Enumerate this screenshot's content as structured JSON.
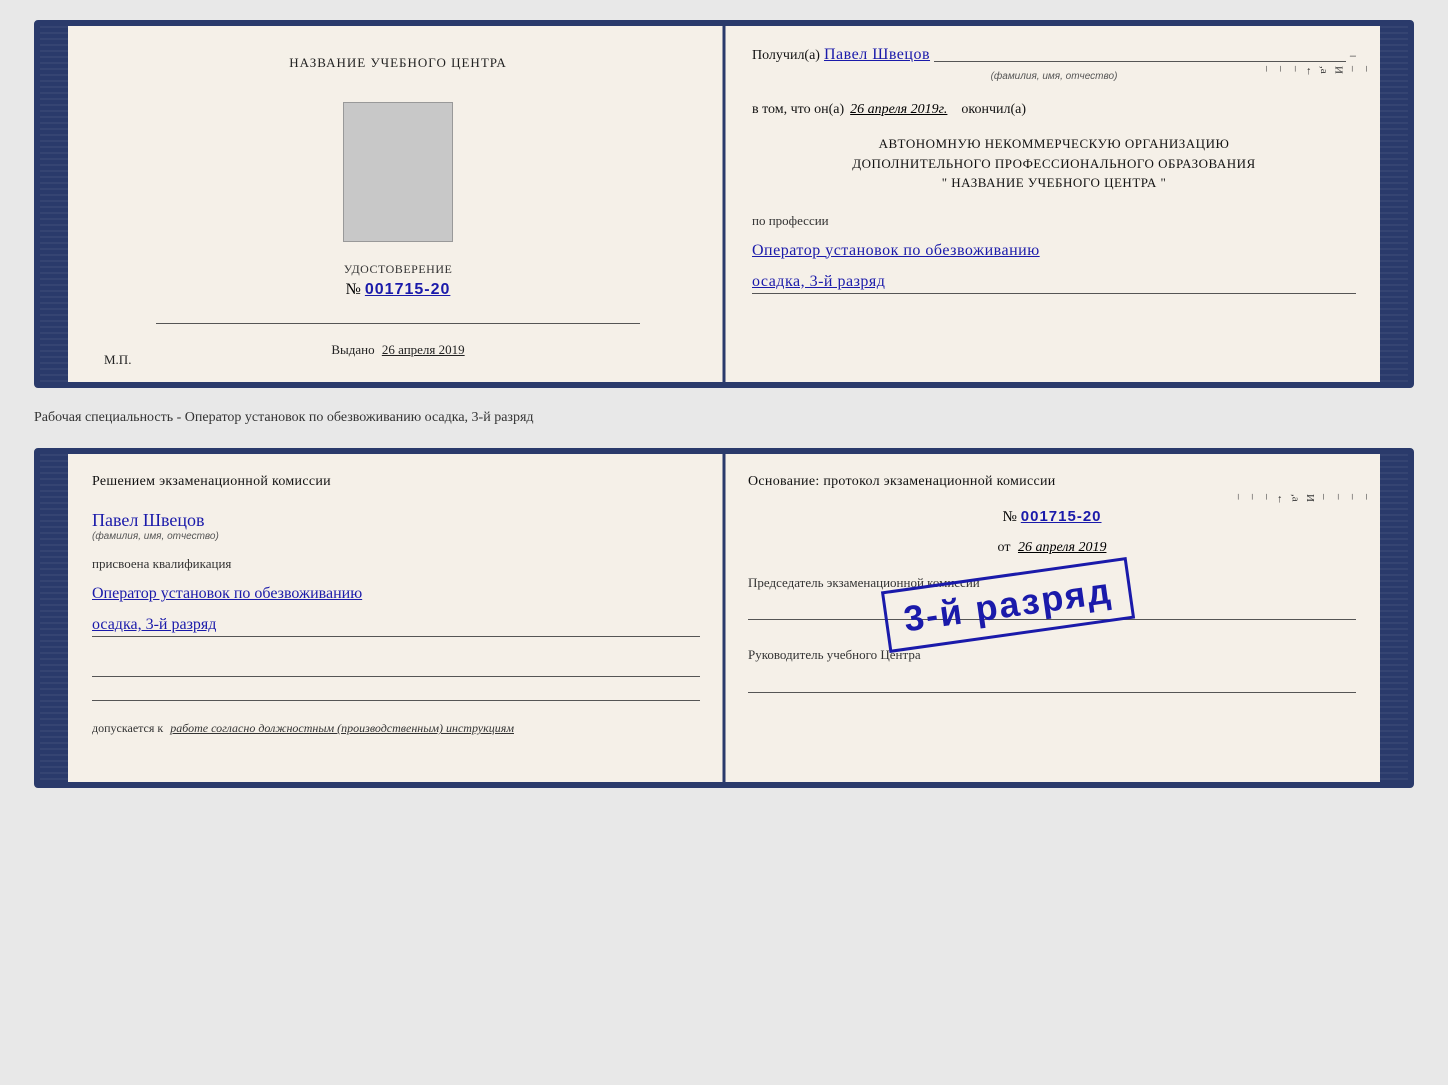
{
  "doc1": {
    "left": {
      "center_title": "НАЗВАНИЕ УЧЕБНОГО ЦЕНТРА",
      "cert_label": "УДОСТОВЕРЕНИЕ",
      "cert_number_prefix": "№",
      "cert_number": "001715-20",
      "issued_label": "Выдано",
      "issued_date": "26 апреля 2019",
      "mp_label": "М.П."
    },
    "right": {
      "received_label": "Получил(а)",
      "received_name": "Павел Швецов",
      "fio_hint": "(фамилия, имя, отчество)",
      "vtom_label": "в том, что он(а)",
      "date_value": "26 апреля 2019г.",
      "okonchil_label": "окончил(а)",
      "org_line1": "АВТОНОМНУЮ НЕКОММЕРЧЕСКУЮ ОРГАНИЗАЦИЮ",
      "org_line2": "ДОПОЛНИТЕЛЬНОГО ПРОФЕССИОНАЛЬНОГО ОБРАЗОВАНИЯ",
      "org_line3": "\"  НАЗВАНИЕ УЧЕБНОГО ЦЕНТРА  \"",
      "po_professii_label": "по профессии",
      "profession_line1": "Оператор установок по обезвоживанию",
      "profession_line2": "осадка, 3-й разряд"
    }
  },
  "between_label": "Рабочая специальность - Оператор установок по обезвоживанию осадка, 3-й разряд",
  "doc2": {
    "left": {
      "resheniem_label": "Решением  экзаменационной  комиссии",
      "person_name": "Павел Швецов",
      "fio_hint": "(фамилия, имя, отчество)",
      "prisvoena_label": "присвоена квалификация",
      "qualification_line1": "Оператор установок по обезвоживанию",
      "qualification_line2": "осадка, 3-й разряд",
      "dopuskaetsya_label": "допускается к",
      "dopuskaetsya_text": "работе согласно должностным (производственным) инструкциям"
    },
    "right": {
      "osnovanie_label": "Основание: протокол экзаменационной  комиссии",
      "number_prefix": "№",
      "number_value": "001715-20",
      "ot_label": "от",
      "ot_date": "26 апреля 2019",
      "predsedatel_label": "Председатель экзаменационной комиссии",
      "rukovoditel_label": "Руководитель учебного Центра"
    },
    "stamp": {
      "text": "3-й разряд"
    }
  },
  "right_edge": {
    "letters": "И а ←"
  }
}
